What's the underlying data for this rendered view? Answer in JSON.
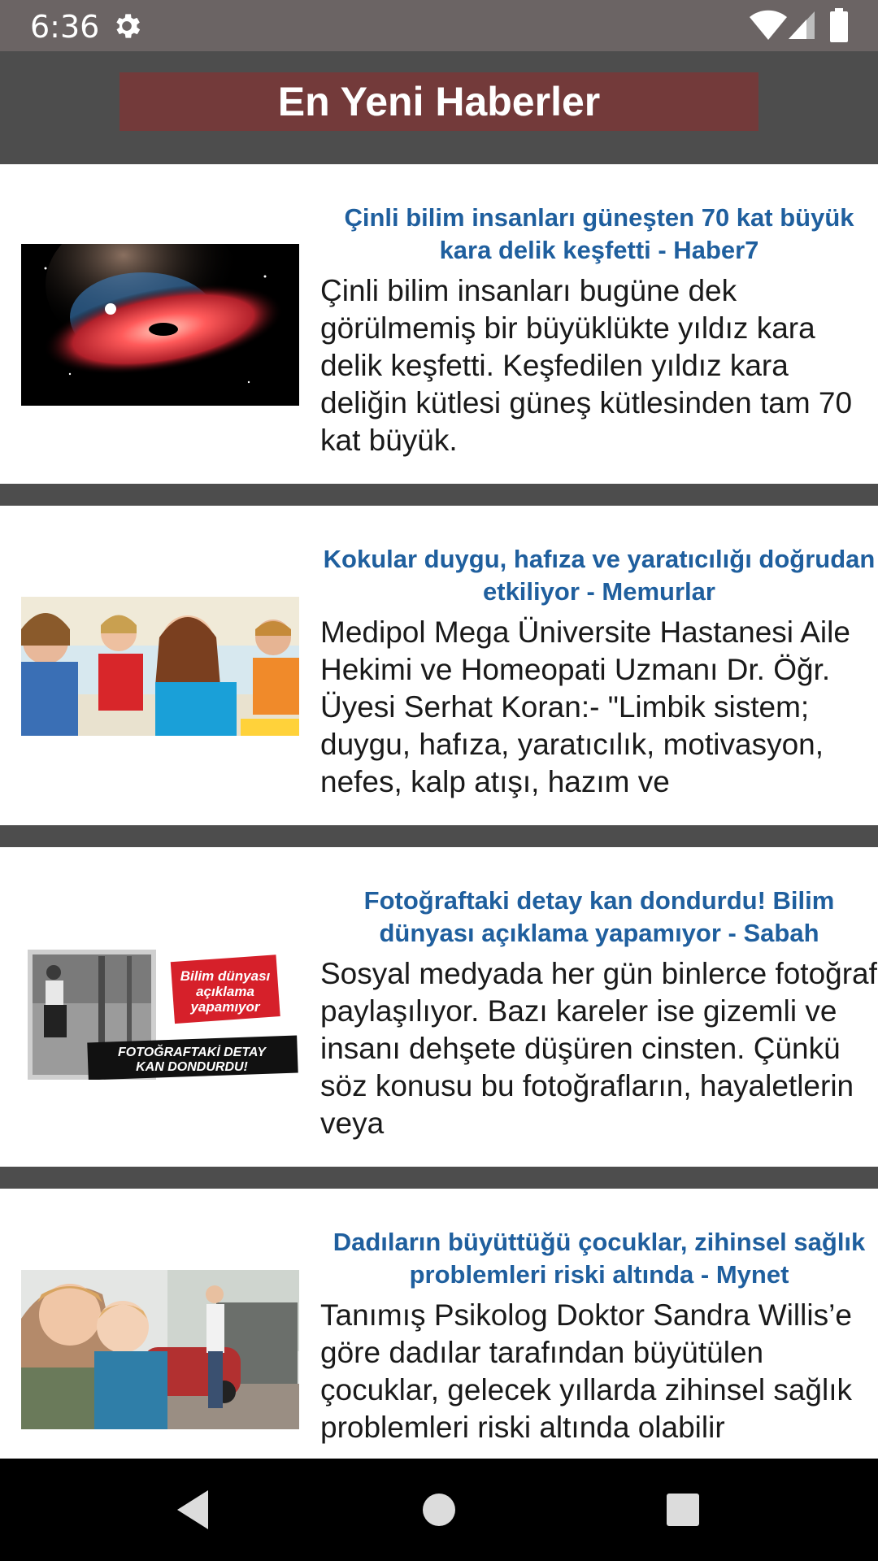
{
  "status_bar": {
    "time": "6:36",
    "icons": [
      "gear-icon",
      "wifi-icon",
      "cell-signal-icon",
      "battery-icon"
    ]
  },
  "app_bar": {
    "title": "En Yeni Haberler",
    "title_bg_color": "#733a3a",
    "bar_color": "#4d4d4d"
  },
  "articles": [
    {
      "headline": "Çinli bilim insanları güneşten 70 kat büyük kara delik keşfetti - Haber7",
      "summary": "Çinli bilim insanları bugüne dek görülmemiş bir büyüklükte yıldız kara delik keşfetti. Keşfedilen yıldız kara deliğin kütlesi güneş kütlesinden tam 70 kat büyük.",
      "image": "black-hole-accretion-disk-image"
    },
    {
      "headline": "Kokular duygu, hafıza ve yaratıcılığı doğrudan etkiliyor - Memurlar",
      "summary": "Medipol Mega Üniversite Hastanesi Aile Hekimi ve Homeopati Uzmanı Dr. Öğr. Üyesi Serhat Koran:- \"Limbik sistem; duygu, hafıza, yaratıcılık, motivasyon, nefes, kalp atışı, hazım ve",
      "image": "children-drawing-image"
    },
    {
      "headline": "Fotoğraftaki detay kan dondurdu! Bilim dünyası açıklama yapamıyor - Sabah",
      "summary": "Sosyal medyada her gün binlerce fotoğraf paylaşılıyor. Bazı kareler ise gizemli ve insanı dehşete düşüren cinsten. Çünkü söz konusu bu fotoğrafların, hayaletlerin veya",
      "image": "old-photo-collage-image",
      "image_texts": {
        "red_label": "Bilim dünyası açıklama yapamıyor",
        "black_label": "FOTOĞRAFTAKİ DETAY KAN DONDURDU!"
      }
    },
    {
      "headline": "Dadıların büyüttüğü çocuklar, zihinsel sağlık problemleri riski altında - Mynet",
      "summary": "Tanımış Psikolog Doktor Sandra Willis’e göre dadılar tarafından büyütülen çocuklar, gelecek yıllarda zihinsel sağlık problemleri riski altında olabilir",
      "image": "nanny-with-child-image"
    }
  ],
  "colors": {
    "headline": "#1f5f9e",
    "separator": "#4d4d4d",
    "status_bar": "#6b6464"
  },
  "nav_bar": {
    "buttons": [
      "back-icon",
      "home-icon",
      "recents-icon"
    ]
  }
}
